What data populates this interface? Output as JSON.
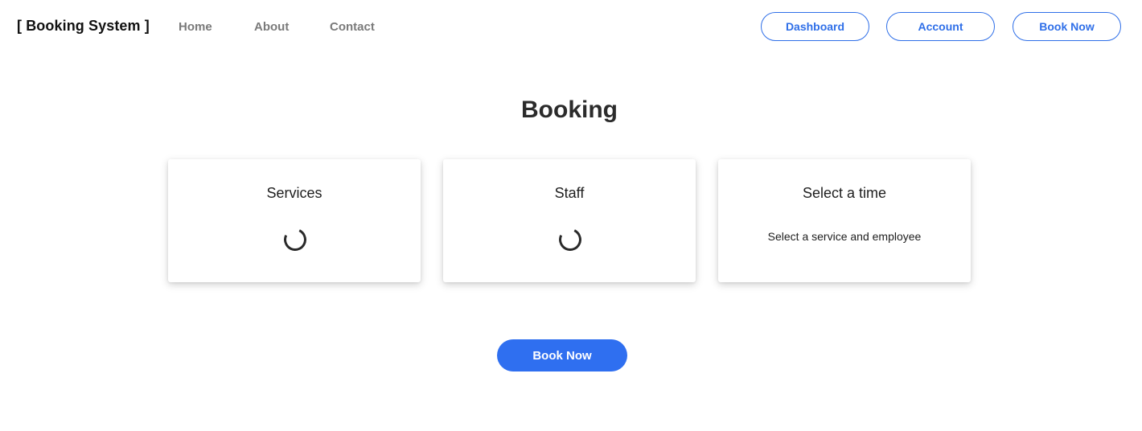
{
  "header": {
    "brand": "[ Booking System ]",
    "nav": {
      "home": "Home",
      "about": "About",
      "contact": "Contact"
    },
    "actions": {
      "dashboard": "Dashboard",
      "account": "Account",
      "book_now": "Book Now"
    }
  },
  "main": {
    "title": "Booking",
    "cards": {
      "services": {
        "title": "Services",
        "state": "loading"
      },
      "staff": {
        "title": "Staff",
        "state": "loading"
      },
      "time": {
        "title": "Select a time",
        "message": "Select a service and employee"
      }
    },
    "cta_label": "Book Now"
  },
  "colors": {
    "accent": "#2f6fe8",
    "cta_background": "#2f6ff0",
    "nav_link": "#7a7a7a",
    "heading": "#2b2b2b"
  },
  "icons": {
    "services_loading": "loading-spinner-icon",
    "staff_loading": "loading-spinner-icon"
  }
}
